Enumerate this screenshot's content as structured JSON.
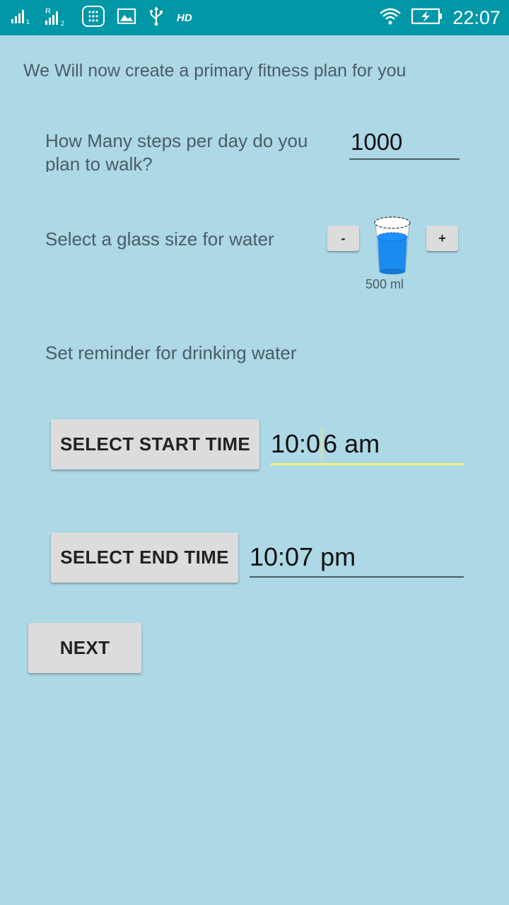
{
  "status_bar": {
    "time": "22:07",
    "hd_label": "HD",
    "roaming_label": "R",
    "sim1_label": "1",
    "sim2_label": "2"
  },
  "intro_text": "We Will now create a primary fitness plan for you",
  "steps": {
    "question": "How Many steps per day do you plan to walk?",
    "value": "1000"
  },
  "water_glass": {
    "question": "Select a glass size for water",
    "decrement_label": "-",
    "increment_label": "+",
    "size_label": "500 ml",
    "fill_color": "#1a8cf0"
  },
  "reminder": {
    "title": "Set reminder for drinking water",
    "start_button_label": "SELECT START TIME",
    "start_time_before_caret": "10:0",
    "start_time_after_caret": "6 am",
    "end_button_label": "SELECT END TIME",
    "end_time": "10:07 pm"
  },
  "next_button_label": "NEXT",
  "colors": {
    "background": "#add8e6",
    "status_bar": "#0097a7",
    "accent_underline": "#eef57a"
  }
}
